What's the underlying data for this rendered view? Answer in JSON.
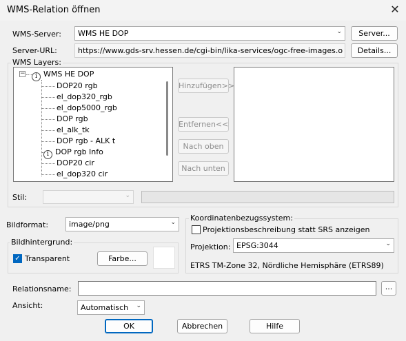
{
  "window": {
    "title": "WMS-Relation öffnen"
  },
  "server": {
    "label": "WMS-Server:",
    "value": "WMS HE DOP",
    "button": "Server..."
  },
  "url": {
    "label": "Server-URL:",
    "value": "https://www.gds-srv.hessen.de/cgi-bin/lika-services/ogc-free-images.ows?lang",
    "button": "Details..."
  },
  "layers": {
    "label": "WMS Layers:",
    "root": "WMS HE DOP",
    "items": [
      "DOP20 rgb",
      "el_dop320_rgb",
      "el_dop5000_rgb",
      "DOP rgb",
      "el_alk_tk",
      "DOP rgb - ALK t",
      "DOP rgb Info",
      "DOP20 cir",
      "el_dop320 cir"
    ],
    "add_button": "Hinzufügen>>",
    "remove_button": "Entfernen<<",
    "up_button": "Nach oben",
    "down_button": "Nach unten",
    "style_label": "Stil:"
  },
  "format": {
    "label": "Bildformat:",
    "value": "image/png"
  },
  "background": {
    "label": "Bildhintergrund:",
    "transparent_label": "Transparent",
    "transparent_checked": true,
    "color_button": "Farbe..."
  },
  "crs": {
    "label": "Koordinatenbezugssystem:",
    "checkbox_label": "Projektionsbeschreibung statt SRS anzeigen",
    "checkbox_checked": false,
    "projection_label": "Projektion:",
    "projection_value": "EPSG:3044",
    "description": "ETRS TM-Zone 32, Nördliche Hemisphäre (ETRS89)"
  },
  "relation": {
    "label": "Relationsname:",
    "value": "",
    "browse_button": "..."
  },
  "view": {
    "label": "Ansicht:",
    "value": "Automatisch"
  },
  "buttons": {
    "ok": "OK",
    "cancel": "Abbrechen",
    "help": "Hilfe"
  },
  "icons": {
    "close": "close-icon",
    "info": "info-icon",
    "dropdown": "chevron-down-icon"
  },
  "colors": {
    "accent": "#0067c0",
    "background": "#f0f0f0"
  }
}
